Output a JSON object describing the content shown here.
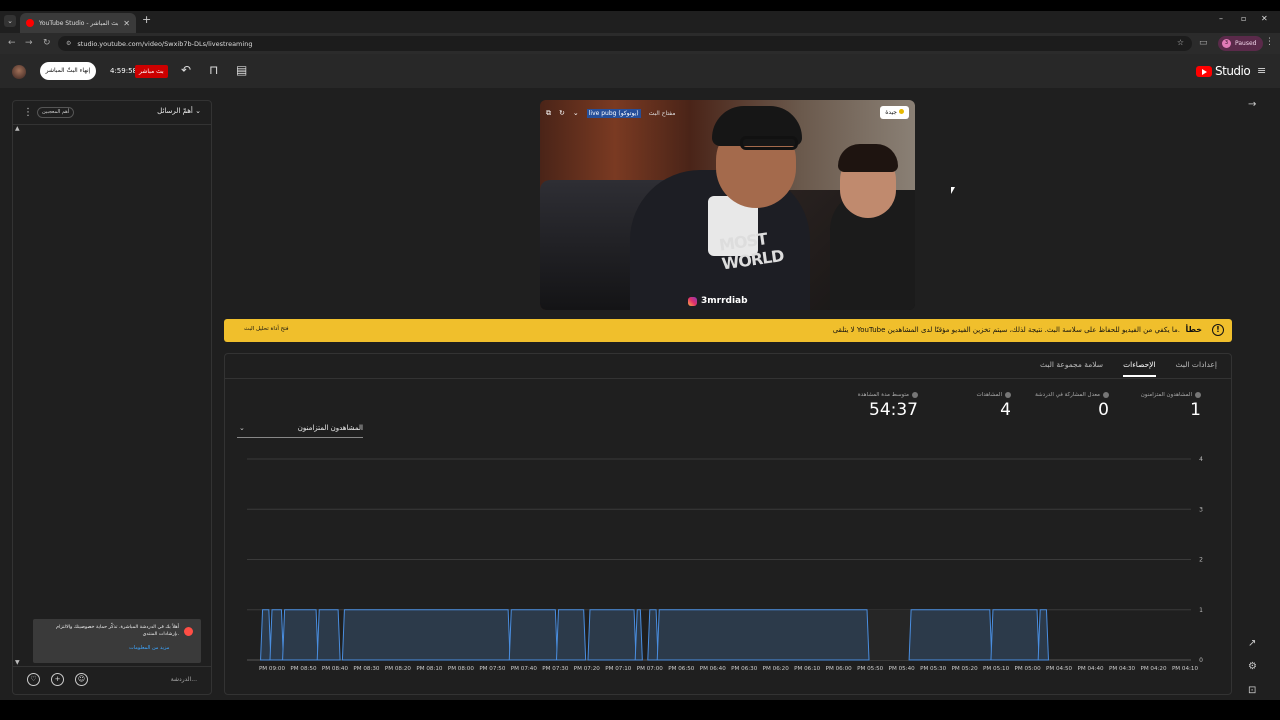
{
  "browser": {
    "tab_title": "YouTube Studio - البث المباشر",
    "url": "studio.youtube.com/video/Swxib7b-DLs/livestreaming",
    "profile_status": "Paused"
  },
  "header": {
    "end_stream_label": "إنهاء البثّ المباشر",
    "timer": "4:59:58",
    "live_badge": "بث مباشر",
    "logo_text": "Studio"
  },
  "chat": {
    "title": "أهمّ الرسائل",
    "top_chip": "أهم المعجبين",
    "notice_text": "أهلاً بك في الدردشة المباشرة. تذكّر حماية خصوصيتك والالتزام بإرشادات المنتدى.",
    "notice_link": "مزيد من المعلومات",
    "input_placeholder": "الدردشة..."
  },
  "preview": {
    "stream_key_label": "مفتاح البث",
    "stream_key_value": "live pubg (يوتوكو)",
    "status": "جيدة",
    "handle": "3mrrdiab",
    "shirt_text": "MOST WORLD"
  },
  "warning": {
    "title": "خطأ",
    "message": "لا يتلقى YouTube ما يكفي من الفيديو للحفاظ على سلاسة البث. نتيجة لذلك، سيتم تخزين الفيديو مؤقتًا لدى المشاهدين.",
    "link": "فتح أداة تحليل البث"
  },
  "tabs": [
    "إعدادات البث",
    "الإحصاءات",
    "سلامة مجموعة البث"
  ],
  "active_tab": "الإحصاءات",
  "stats": [
    {
      "label": "المشاهدون المتزامنون",
      "value": "1"
    },
    {
      "label": "معدل المشاركة في الدردشة",
      "value": "0"
    },
    {
      "label": "المشاهدات",
      "value": "4"
    },
    {
      "label": "متوسط مدة المشاهدة",
      "value": "54:37"
    }
  ],
  "metric_select": "المشاهدون المتزامنون",
  "chart_data": {
    "type": "area",
    "title": "",
    "ylabel": "",
    "ylim": [
      0,
      4
    ],
    "yticks": [
      "0",
      "1",
      "2",
      "3",
      "4"
    ],
    "x_labels": [
      "PM 09:00",
      "PM 08:50",
      "PM 08:40",
      "PM 08:30",
      "PM 08:20",
      "PM 08:10",
      "PM 08:00",
      "PM 07:50",
      "PM 07:40",
      "PM 07:30",
      "PM 07:20",
      "PM 07:10",
      "PM 07:00",
      "PM 06:50",
      "PM 06:40",
      "PM 06:30",
      "PM 06:20",
      "PM 06:10",
      "PM 06:00",
      "PM 05:50",
      "PM 05:40",
      "PM 05:30",
      "PM 05:20",
      "PM 05:10",
      "PM 05:00",
      "PM 04:50",
      "PM 04:40",
      "PM 04:30",
      "PM 04:20",
      "PM 04:10"
    ],
    "segments": [
      {
        "from": "PM 09:03",
        "to": "PM 09:01",
        "value": 1
      },
      {
        "from": "PM 09:00",
        "to": "PM 08:57",
        "value": 1
      },
      {
        "from": "PM 08:56",
        "to": "PM 08:46",
        "value": 1
      },
      {
        "from": "PM 08:45",
        "to": "PM 08:39",
        "value": 1
      },
      {
        "from": "PM 08:37",
        "to": "PM 07:45",
        "value": 1
      },
      {
        "from": "PM 07:44",
        "to": "PM 07:30",
        "value": 1
      },
      {
        "from": "PM 07:29",
        "to": "PM 07:21",
        "value": 1
      },
      {
        "from": "PM 07:19",
        "to": "PM 07:05",
        "value": 1
      },
      {
        "from": "PM 07:04",
        "to": "PM 07:03",
        "value": 1
      },
      {
        "from": "PM 07:00",
        "to": "PM 06:58",
        "value": 1
      },
      {
        "from": "PM 06:57",
        "to": "PM 05:51",
        "value": 1
      },
      {
        "from": "PM 05:37",
        "to": "PM 05:12",
        "value": 1
      },
      {
        "from": "PM 05:11",
        "to": "PM 04:57",
        "value": 1
      },
      {
        "from": "PM 04:56",
        "to": "PM 04:54",
        "value": 1
      }
    ]
  }
}
